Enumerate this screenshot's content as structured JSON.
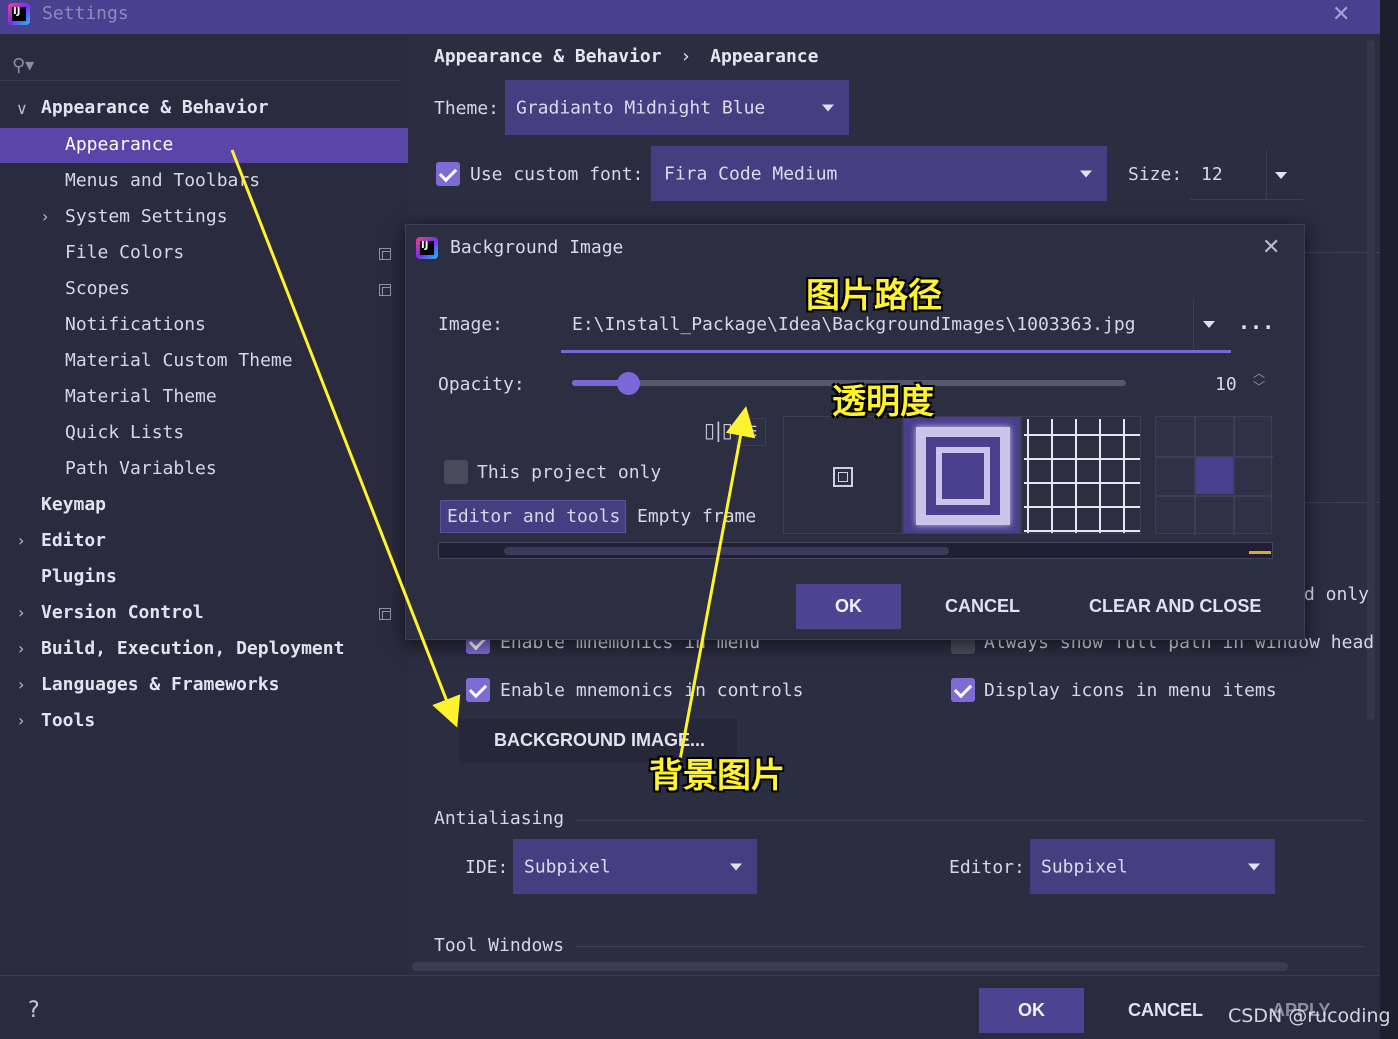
{
  "window": {
    "title": "Settings",
    "logo_text": "IJ"
  },
  "sidebar": {
    "items": [
      {
        "label": "Appearance & Behavior"
      },
      {
        "label": "Appearance"
      },
      {
        "label": "Menus and Toolbars"
      },
      {
        "label": "System Settings"
      },
      {
        "label": "File Colors"
      },
      {
        "label": "Scopes"
      },
      {
        "label": "Notifications"
      },
      {
        "label": "Material Custom Theme"
      },
      {
        "label": "Material Theme"
      },
      {
        "label": "Quick Lists"
      },
      {
        "label": "Path Variables"
      },
      {
        "label": "Keymap"
      },
      {
        "label": "Editor"
      },
      {
        "label": "Plugins"
      },
      {
        "label": "Version Control"
      },
      {
        "label": "Build, Execution, Deployment"
      },
      {
        "label": "Languages & Frameworks"
      },
      {
        "label": "Tools"
      }
    ]
  },
  "breadcrumb": {
    "part1": "Appearance & Behavior",
    "separator": "›",
    "part2": "Appearance"
  },
  "theme": {
    "label": "Theme:",
    "value": "Gradianto Midnight Blue"
  },
  "font": {
    "checkbox_label": "Use custom font:",
    "value": "Fira Code Medium",
    "size_label": "Size:",
    "size_value": "12"
  },
  "dialog": {
    "title": "Background Image",
    "image_label": "Image:",
    "image_path": "E:\\Install_Package\\Idea\\BackgroundImages\\1003363.jpg",
    "more_label": "...",
    "opacity_label": "Opacity:",
    "opacity_value": "10",
    "opacity_fraction": 0.1,
    "project_only_label": "This project only",
    "tab_editor": "Editor and tools",
    "tab_empty": "Empty frame",
    "ok": "OK",
    "cancel": "CANCEL",
    "clear_close": "CLEAR AND CLOSE"
  },
  "background_options": {
    "partial_right": "d only",
    "mnemonics_menu": "Enable mnemonics in menu",
    "full_path": "Always show full path in window head",
    "mnemonics_controls": "Enable mnemonics in controls",
    "display_icons": "Display icons in menu items",
    "background_image_button": "BACKGROUND IMAGE..."
  },
  "antialiasing": {
    "section": "Antialiasing",
    "ide_label": "IDE:",
    "ide_value": "Subpixel",
    "editor_label": "Editor:",
    "editor_value": "Subpixel"
  },
  "tool_windows": {
    "section": "Tool Windows"
  },
  "footer": {
    "help": "?",
    "ok": "OK",
    "cancel": "CANCEL",
    "apply": "APPLY"
  },
  "annotations": {
    "image_path": "图片路径",
    "opacity": "透明度",
    "background_image": "背景图片"
  },
  "watermark": "CSDN @rucoding",
  "colors": {
    "accent": "#5a45a8",
    "title_bar": "#4b3f8f",
    "annotation": "#fff22e"
  }
}
